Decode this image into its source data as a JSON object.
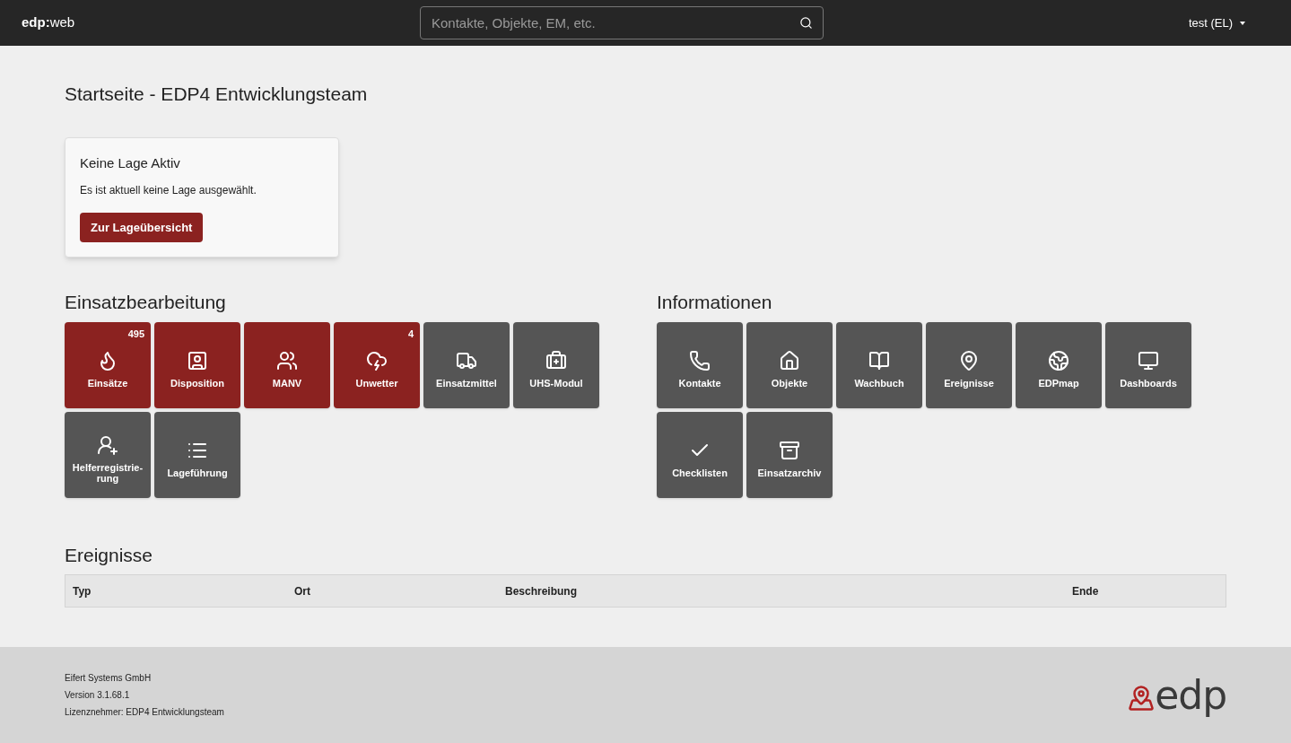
{
  "navbar": {
    "brand": "**edp:**web",
    "search": {
      "placeholder": "Kontakte, Objekte, EM, etc."
    },
    "user": "test (EL)"
  },
  "page_title": "Startseite - EDP4 Entwicklungsteam",
  "lage_card": {
    "title": "Keine Lage Aktiv",
    "text": "Es ist aktuell keine Lage ausgewählt.",
    "button": "Zur Lageübersicht"
  },
  "sections": [
    {
      "title": "Einsatzbearbeitung",
      "tiles": [
        {
          "label": "Einsätze",
          "badge": "495",
          "color": "#8b2220"
        },
        {
          "label": "Disposition",
          "color": "#8b2220"
        },
        {
          "label": "MANV",
          "color": "#8b2220"
        },
        {
          "label": "Unwetter",
          "badge": "4",
          "color": "#8b2220"
        },
        {
          "label": "Einsatzmittel",
          "color": "#555555"
        },
        {
          "label": "UHS-Modul",
          "color": "#555555"
        },
        {
          "label": "Helferregistrie-rung",
          "color": "#555555"
        },
        {
          "label": "Lageführung",
          "color": "#555555"
        }
      ]
    },
    {
      "title": "Informationen",
      "tiles": [
        {
          "label": "Kontakte",
          "color": "#555555"
        },
        {
          "label": "Objekte",
          "color": "#555555"
        },
        {
          "label": "Wachbuch",
          "color": "#555555"
        },
        {
          "label": "Ereignisse",
          "color": "#555555"
        },
        {
          "label": "EDPmap",
          "color": "#555555"
        },
        {
          "label": "Dashboards",
          "color": "#555555"
        },
        {
          "label": "Checklisten",
          "color": "#555555"
        },
        {
          "label": "Einsatzarchiv",
          "color": "#555555"
        }
      ]
    }
  ],
  "events": {
    "title": "Ereignisse",
    "table": {
      "columns": [
        "Typ",
        "Ort",
        "Beschreibung",
        "Ende"
      ]
    }
  },
  "footer": {
    "lines": [
      "Eifert Systems GmbH",
      "Version 3.1.68.1",
      "Lizenznehmer: EDP4 Entwicklungsteam"
    ],
    "logo_text": "edp"
  }
}
